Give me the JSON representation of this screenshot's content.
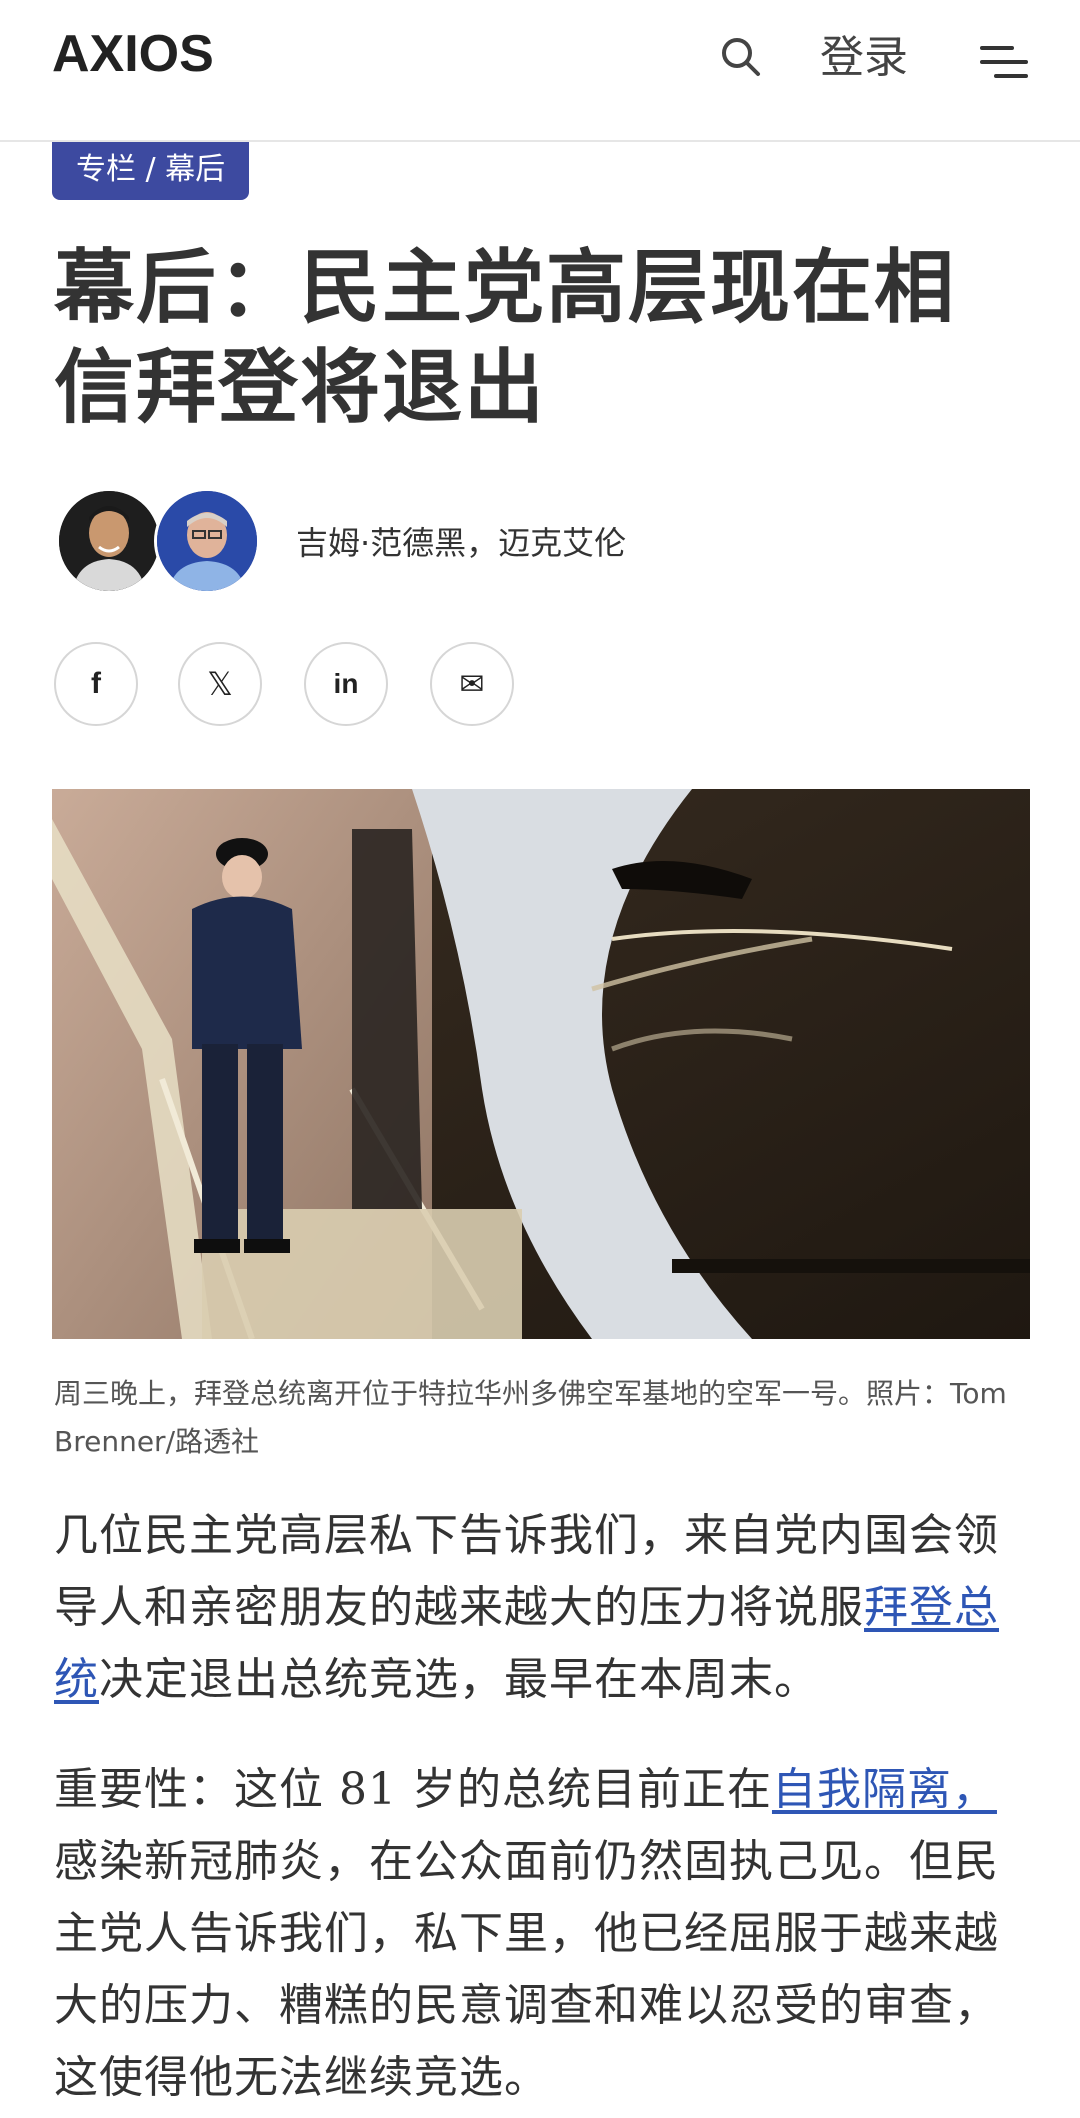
{
  "header": {
    "logo": "AXIOS",
    "login_label": "登录",
    "search_icon": "search-icon",
    "menu_icon": "hamburger-menu-icon"
  },
  "badge": {
    "label": "专栏 / 幕后"
  },
  "headline": "幕后：民主党高层现在相信拜登将退出",
  "authors": {
    "names": "吉姆·范德黑，迈克艾伦",
    "avatars": [
      "author-avatar-1",
      "author-avatar-2"
    ]
  },
  "share": [
    {
      "name": "facebook",
      "glyph": "f"
    },
    {
      "name": "x",
      "glyph": "𝕏"
    },
    {
      "name": "linkedin",
      "glyph": "in"
    },
    {
      "name": "email",
      "glyph": "✉"
    }
  ],
  "caption": "周三晚上，拜登总统离开位于特拉华州多佛空军基地的空军一号。照片：Tom Brenner/路透社",
  "body": {
    "p1_before": "几位民主党高层私下告诉我们，来自党内国会领导人和亲密朋友的越来越大的压力将说服",
    "p1_link": "拜登总统",
    "p1_after": "决定退出总统竞选，最早在本周末。",
    "p2_lead": "重要性：这位 81 岁的总统目前正在",
    "p2_link": "自我隔离，",
    "p2_after": "感染新冠肺炎，在公众面前仍然固执己见。但民主党人告诉我们，私下里，他已经屈服于越来越大的压力、糟糕的民意调查和难以忍受的审查，这使得他无法继续竞选。"
  },
  "colors": {
    "brand": "#3d4aa0",
    "link": "#2e56b5",
    "text": "#333333"
  }
}
